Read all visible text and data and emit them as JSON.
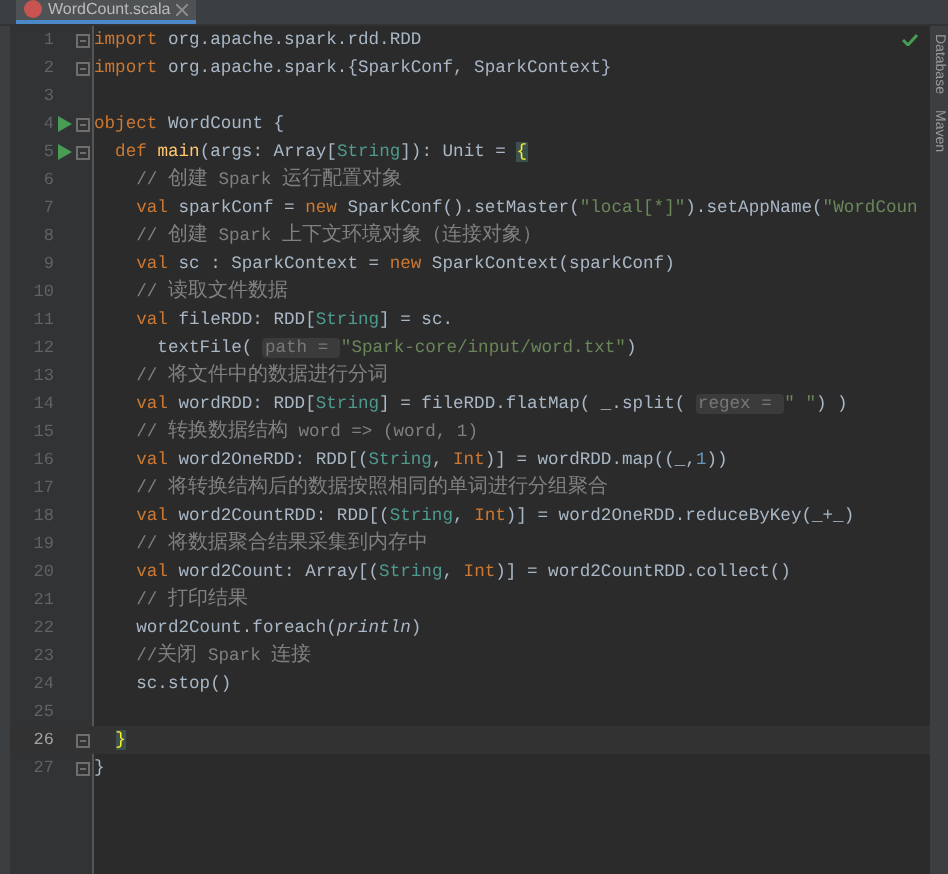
{
  "tab": {
    "title": "WordCount.scala",
    "selected": true
  },
  "status": {
    "kind": "ok"
  },
  "side_tools": [
    "Database",
    "Maven"
  ],
  "lines": [
    {
      "number": "1",
      "current": false,
      "run": false,
      "fold": true,
      "tokens": [
        {
          "kind": "kw",
          "text": "import"
        },
        {
          "kind": "plain",
          "text": " org.apache.spark.rdd.RDD"
        }
      ]
    },
    {
      "number": "2",
      "current": false,
      "run": false,
      "fold": true,
      "tokens": [
        {
          "kind": "kw",
          "text": "import"
        },
        {
          "kind": "plain",
          "text": " org.apache.spark.{SparkConf, SparkContext}"
        }
      ]
    },
    {
      "number": "3",
      "current": false,
      "run": false,
      "fold": false
    },
    {
      "number": "4",
      "current": false,
      "run": true,
      "fold": true,
      "tokens": [
        {
          "kind": "kw",
          "text": "object"
        },
        {
          "kind": "plain",
          "text": " WordCount {"
        }
      ]
    },
    {
      "number": "5",
      "current": false,
      "run": true,
      "fold": true,
      "tokens": [
        {
          "kind": "kw",
          "text": "  def "
        },
        {
          "kind": "fn",
          "text": "main"
        },
        {
          "kind": "plain",
          "text": "(args: Array["
        },
        {
          "kind": "type",
          "text": "String"
        },
        {
          "kind": "plain",
          "text": "]): Unit = "
        },
        {
          "kind": "brace",
          "text": "{"
        }
      ]
    },
    {
      "number": "6",
      "current": false,
      "run": false,
      "fold": false,
      "tokens": [
        {
          "kind": "comment",
          "text": "    // 创建 Spark 运行配置对象"
        }
      ]
    },
    {
      "number": "7",
      "current": false,
      "run": false,
      "fold": false,
      "tokens": [
        {
          "kind": "kw",
          "text": "    val"
        },
        {
          "kind": "plain",
          "text": " sparkConf = "
        },
        {
          "kind": "kw",
          "text": "new"
        },
        {
          "kind": "plain",
          "text": " SparkConf().setMaster("
        },
        {
          "kind": "str",
          "text": "\"local[*]\""
        },
        {
          "kind": "plain",
          "text": ").setAppName("
        },
        {
          "kind": "str",
          "text": "\"WordCoun"
        }
      ]
    },
    {
      "number": "8",
      "current": false,
      "run": false,
      "fold": false,
      "tokens": [
        {
          "kind": "comment",
          "text": "    // 创建 Spark 上下文环境对象（连接对象）"
        }
      ]
    },
    {
      "number": "9",
      "current": false,
      "run": false,
      "fold": false,
      "tokens": [
        {
          "kind": "kw",
          "text": "    val"
        },
        {
          "kind": "plain",
          "text": " sc : SparkContext = "
        },
        {
          "kind": "kw",
          "text": "new"
        },
        {
          "kind": "plain",
          "text": " SparkContext(sparkConf)"
        }
      ]
    },
    {
      "number": "10",
      "current": false,
      "run": false,
      "fold": false,
      "tokens": [
        {
          "kind": "comment",
          "text": "    // 读取文件数据"
        }
      ]
    },
    {
      "number": "11",
      "current": false,
      "run": false,
      "fold": false,
      "tokens": [
        {
          "kind": "kw",
          "text": "    val"
        },
        {
          "kind": "plain",
          "text": " fileRDD: RDD["
        },
        {
          "kind": "type",
          "text": "String"
        },
        {
          "kind": "plain",
          "text": "] = sc."
        }
      ]
    },
    {
      "number": "12",
      "current": false,
      "run": false,
      "fold": false,
      "tokens": [
        {
          "kind": "plain",
          "text": "      textFile( "
        },
        {
          "kind": "hint",
          "text": "path = "
        },
        {
          "kind": "str",
          "text": "\"Spark-core/input/word.txt\""
        },
        {
          "kind": "plain",
          "text": ")"
        }
      ]
    },
    {
      "number": "13",
      "current": false,
      "run": false,
      "fold": false,
      "tokens": [
        {
          "kind": "comment",
          "text": "    // 将文件中的数据进行分词"
        }
      ]
    },
    {
      "number": "14",
      "current": false,
      "run": false,
      "fold": false,
      "tokens": [
        {
          "kind": "kw",
          "text": "    val"
        },
        {
          "kind": "plain",
          "text": " wordRDD: RDD["
        },
        {
          "kind": "type",
          "text": "String"
        },
        {
          "kind": "plain",
          "text": "] = fileRDD.flatMap( _.split( "
        },
        {
          "kind": "hint",
          "text": "regex = "
        },
        {
          "kind": "str",
          "text": "\" \""
        },
        {
          "kind": "plain",
          "text": ") )"
        }
      ]
    },
    {
      "number": "15",
      "current": false,
      "run": false,
      "fold": false,
      "tokens": [
        {
          "kind": "comment",
          "text": "    // 转换数据结构 word => (word, 1)"
        }
      ]
    },
    {
      "number": "16",
      "current": false,
      "run": false,
      "fold": false,
      "tokens": [
        {
          "kind": "kw",
          "text": "    val"
        },
        {
          "kind": "plain",
          "text": " word2OneRDD: RDD[("
        },
        {
          "kind": "type",
          "text": "String"
        },
        {
          "kind": "plain",
          "text": ", "
        },
        {
          "kind": "kwtype",
          "text": "Int"
        },
        {
          "kind": "plain",
          "text": ")] = wordRDD.map((_,"
        },
        {
          "kind": "num",
          "text": "1"
        },
        {
          "kind": "plain",
          "text": "))"
        }
      ]
    },
    {
      "number": "17",
      "current": false,
      "run": false,
      "fold": false,
      "tokens": [
        {
          "kind": "comment",
          "text": "    // 将转换结构后的数据按照相同的单词进行分组聚合"
        }
      ]
    },
    {
      "number": "18",
      "current": false,
      "run": false,
      "fold": false,
      "tokens": [
        {
          "kind": "kw",
          "text": "    val"
        },
        {
          "kind": "plain",
          "text": " word2CountRDD: RDD[("
        },
        {
          "kind": "type",
          "text": "String"
        },
        {
          "kind": "plain",
          "text": ", "
        },
        {
          "kind": "kwtype",
          "text": "Int"
        },
        {
          "kind": "plain",
          "text": ")] = word2OneRDD.reduceByKey(_+_)"
        }
      ]
    },
    {
      "number": "19",
      "current": false,
      "run": false,
      "fold": false,
      "tokens": [
        {
          "kind": "comment",
          "text": "    // 将数据聚合结果采集到内存中"
        }
      ]
    },
    {
      "number": "20",
      "current": false,
      "run": false,
      "fold": false,
      "tokens": [
        {
          "kind": "kw",
          "text": "    val"
        },
        {
          "kind": "plain",
          "text": " word2Count: Array[("
        },
        {
          "kind": "type",
          "text": "String"
        },
        {
          "kind": "plain",
          "text": ", "
        },
        {
          "kind": "kwtype",
          "text": "Int"
        },
        {
          "kind": "plain",
          "text": ")] = word2CountRDD.collect()"
        }
      ]
    },
    {
      "number": "21",
      "current": false,
      "run": false,
      "fold": false,
      "tokens": [
        {
          "kind": "comment",
          "text": "    // 打印结果"
        }
      ]
    },
    {
      "number": "22",
      "current": false,
      "run": false,
      "fold": false,
      "tokens": [
        {
          "kind": "plain",
          "text": "    word2Count.foreach("
        },
        {
          "kind": "italic",
          "text": "println"
        },
        {
          "kind": "plain",
          "text": ")"
        }
      ]
    },
    {
      "number": "23",
      "current": false,
      "run": false,
      "fold": false,
      "tokens": [
        {
          "kind": "comment",
          "text": "    //关闭 Spark 连接"
        }
      ]
    },
    {
      "number": "24",
      "current": false,
      "run": false,
      "fold": false,
      "tokens": [
        {
          "kind": "plain",
          "text": "    sc.stop()"
        }
      ]
    },
    {
      "number": "25",
      "current": false,
      "run": false,
      "fold": false
    },
    {
      "number": "26",
      "current": true,
      "run": false,
      "fold": true,
      "tokens": [
        {
          "kind": "brace",
          "text": "  }"
        }
      ]
    },
    {
      "number": "27",
      "current": false,
      "run": false,
      "fold": true,
      "tokens": [
        {
          "kind": "plain",
          "text": "}"
        }
      ]
    }
  ]
}
